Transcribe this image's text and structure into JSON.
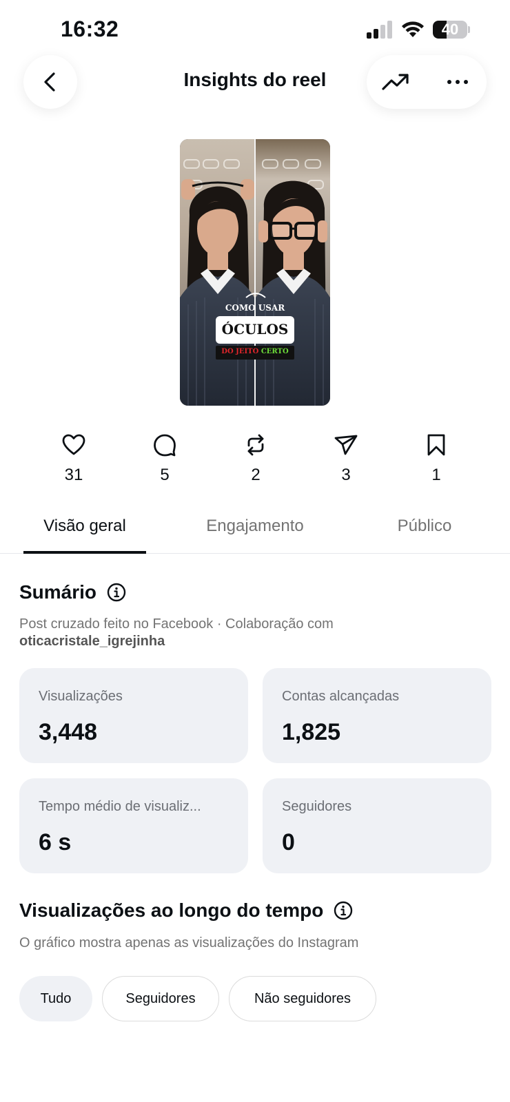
{
  "status_bar": {
    "time": "16:32",
    "battery_level": "40",
    "battery_fraction": 0.4
  },
  "header": {
    "title": "Insights do reel"
  },
  "reel": {
    "overlay_line1": "COMO USAR",
    "overlay_line2": "ÓCULOS",
    "overlay_line3a": "DO JEITO",
    "overlay_line3b": "CERTO"
  },
  "stats": [
    {
      "icon": "heart-icon",
      "value": "31"
    },
    {
      "icon": "comment-icon",
      "value": "5"
    },
    {
      "icon": "repost-icon",
      "value": "2"
    },
    {
      "icon": "share-icon",
      "value": "3"
    },
    {
      "icon": "bookmark-icon",
      "value": "1"
    }
  ],
  "tabs": [
    {
      "label": "Visão geral",
      "active": true
    },
    {
      "label": "Engajamento",
      "active": false
    },
    {
      "label": "Público",
      "active": false
    }
  ],
  "summary": {
    "title": "Sumário",
    "subtitle_text": "Post cruzado feito no Facebook · Colaboração com",
    "collaborator": "oticacristale_igrejinha",
    "cards": [
      {
        "label": "Visualizações",
        "value": "3,448"
      },
      {
        "label": "Contas alcançadas",
        "value": "1,825"
      },
      {
        "label": "Tempo médio de visualiz...",
        "value": "6 s"
      },
      {
        "label": "Seguidores",
        "value": "0"
      }
    ]
  },
  "views_over_time": {
    "title": "Visualizações ao longo do tempo",
    "subtitle": "O gráfico mostra apenas as visualizações do Instagram",
    "filters": [
      {
        "label": "Tudo",
        "active": true
      },
      {
        "label": "Seguidores",
        "active": false
      },
      {
        "label": "Não seguidores",
        "active": false
      }
    ]
  },
  "colors": {
    "text": "#0c1014",
    "muted": "#737373",
    "card_bg": "#eff1f5",
    "accent_red": "#e0262b",
    "accent_green": "#6ddc3a"
  }
}
